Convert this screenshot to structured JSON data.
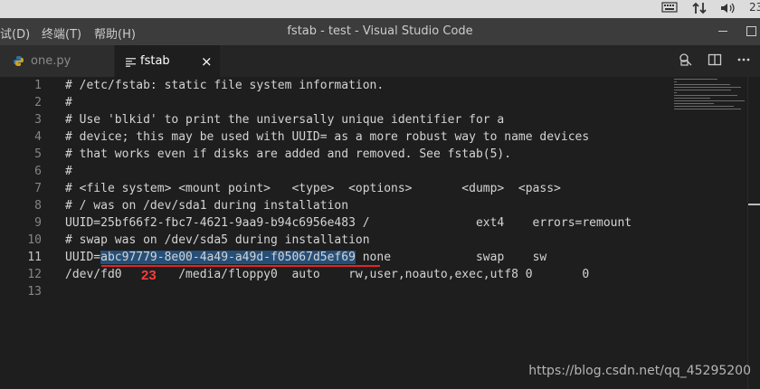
{
  "system_bar": {
    "time": "23"
  },
  "menu": [
    "试(D)",
    "终端(T)",
    "帮助(H)"
  ],
  "window_title": "fstab - test - Visual Studio Code",
  "tabs": [
    {
      "label": "one.py",
      "icon": "python-icon"
    },
    {
      "label": "fstab",
      "icon": "list-icon",
      "close": "×"
    }
  ],
  "editor": {
    "lines": [
      {
        "num": "1",
        "text": "# /etc/fstab: static file system information."
      },
      {
        "num": "2",
        "text": "#"
      },
      {
        "num": "3",
        "text": "# Use 'blkid' to print the universally unique identifier for a"
      },
      {
        "num": "4",
        "text": "# device; this may be used with UUID= as a more robust way to name devices"
      },
      {
        "num": "5",
        "text": "# that works even if disks are added and removed. See fstab(5)."
      },
      {
        "num": "6",
        "text": "#"
      },
      {
        "num": "7",
        "text": "# <file system> <mount point>   <type>  <options>       <dump>  <pass>"
      },
      {
        "num": "8",
        "text": "# / was on /dev/sda1 during installation"
      },
      {
        "num": "9",
        "text": "UUID=25bf66f2-fbc7-4621-9aa9-b94c6956e483 /               ext4    errors=remount"
      },
      {
        "num": "10",
        "text": "# swap was on /dev/sda5 during installation"
      },
      {
        "num": "11",
        "pre": "UUID=",
        "selected": "abc97779-8e00-4a49-a49d-f05067d5ef69",
        "post": " none            swap    sw"
      },
      {
        "num": "12",
        "text": "/dev/fd0        /media/floppy0  auto    rw,user,noauto,exec,utf8 0       0"
      },
      {
        "num": "13",
        "text": ""
      }
    ]
  },
  "annotation": "23",
  "watermark": "https://blog.csdn.net/qq_45295200"
}
